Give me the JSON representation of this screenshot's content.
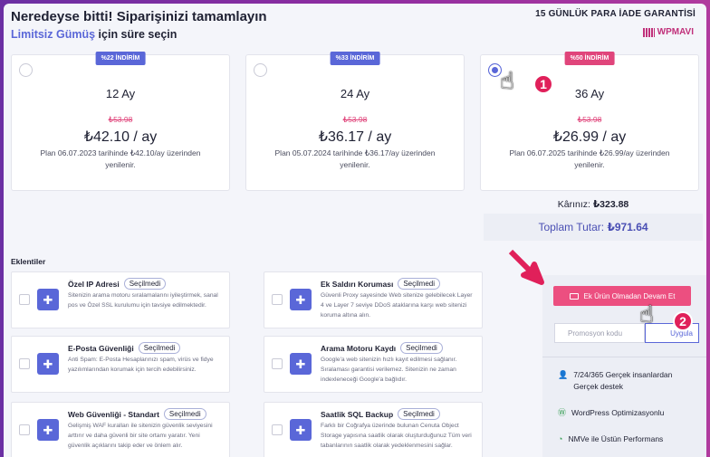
{
  "header": {
    "title": "Neredeyse bitti! Siparişinizi tamamlayın",
    "subtitle_plan": "Limitsiz Gümüş",
    "subtitle_rest": " için süre seçin",
    "guarantee": "15 GÜNLÜK PARA İADE GARANTİSİ",
    "brand": "WPMAVI"
  },
  "plans": [
    {
      "badge": "%22 İNDİRİM",
      "term": "12 Ay",
      "old_price": "₺53.98",
      "price": "₺42.10 / ay",
      "note": "Plan 06.07.2023 tarihinde ₺42.10/ay üzerinden yenilenir.",
      "selected": false
    },
    {
      "badge": "%33 İNDİRİM",
      "term": "24 Ay",
      "old_price": "₺53.98",
      "price": "₺36.17 / ay",
      "note": "Plan 05.07.2024 tarihinde ₺36.17/ay üzerinden yenilenir.",
      "selected": false
    },
    {
      "badge": "%50 İNDİRİM",
      "term": "36 Ay",
      "old_price": "₺53.98",
      "price": "₺26.99 / ay",
      "note": "Plan 06.07.2025 tarihinde ₺26.99/ay üzerinden yenilenir.",
      "selected": true
    }
  ],
  "summary": {
    "savings_label": "Kârınız:",
    "savings_value": "₺323.88",
    "total_label": "Toplam Tutar:",
    "total_value": "₺971.64"
  },
  "addons_title": "Eklentiler",
  "addons": [
    {
      "name": "Özel IP Adresi",
      "tag": "Seçilmedi",
      "desc": "Sitenizin arama motoru sıralamalarını iyileştirmek, sanal pos ve Özel SSL kurulumu için tavsiye edilmektedir."
    },
    {
      "name": "Ek Saldırı Koruması",
      "tag": "Seçilmedi",
      "desc": "Güvenli Proxy sayesinde Web sitenize gelebilecek Layer 4 ve Layer 7 seviye DDoS ataklarına karşı web sitenizi koruma altına alın."
    },
    {
      "name": "E-Posta Güvenliği",
      "tag": "Seçilmedi",
      "desc": "Anti Spam: E-Posta Hesaplarınızı spam, virüs ve fidye yazılımlarından korumak için tercih edebilirsiniz."
    },
    {
      "name": "Arama Motoru Kaydı",
      "tag": "Seçilmedi",
      "desc": "Google'a web sitenizin hızlı kayıt edilmesi sağlanır. Sıralaması garantisi verilemez. Sitenizin ne zaman indexleneceği Google'a bağlıdır."
    },
    {
      "name": "Web Güvenliği - Standart",
      "tag": "Seçilmedi",
      "desc": "Gelişmiş WAF kuralları ile sitenizin güvenlik seviyesini arttırır ve daha güvenli bir site ortamı yaratır. Yeni güvenlik açıklarını takip eder ve önlem alır."
    },
    {
      "name": "Saatlik SQL Backup",
      "tag": "Seçilmedi",
      "desc": "Farklı bir Coğrafya üzerinde bulunan Cenuta Object Storage yapısına saatlik olarak oluşturduğunuz Tüm veri tabanlarının saatlik olarak yedeklenmesini sağlar."
    }
  ],
  "sidebar": {
    "continue_label": "Ek Ürün Olmadan Devam Et",
    "promo_placeholder": "Promosyon kodu",
    "apply_label": "Uygula",
    "features": [
      {
        "icon": "user-icon",
        "text": "7/24/365 Gerçek insanlardan Gerçek destek"
      },
      {
        "icon": "wordpress-icon",
        "text": "WordPress Optimizasyonlu"
      },
      {
        "icon": "speed-icon",
        "text": "NMVe ile Üstün Performans"
      }
    ]
  },
  "annotations": {
    "step1": "1",
    "step2": "2"
  },
  "colors": {
    "accent": "#5a67d8",
    "pink": "#ec4f80",
    "badge_pink": "#e0457b"
  }
}
